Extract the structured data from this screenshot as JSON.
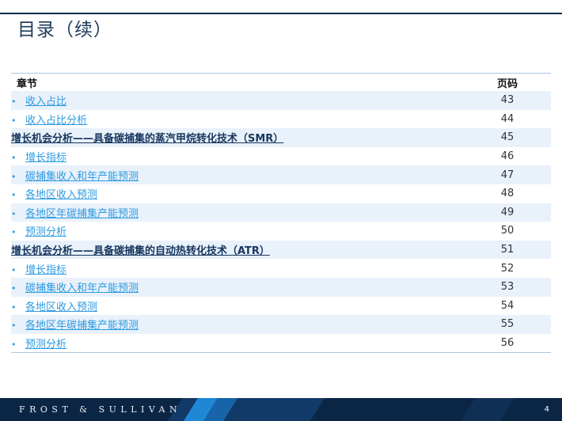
{
  "page": {
    "title": "目录（续）",
    "page_number": "4"
  },
  "table": {
    "col_section": "章节",
    "col_page": "页码",
    "rows": [
      {
        "kind": "sub",
        "label": "收入占比",
        "page": "43"
      },
      {
        "kind": "sub",
        "label": "收入占比分析",
        "page": "44"
      },
      {
        "kind": "head",
        "label": "增长机会分析——具备碳捕集的蒸汽甲烷转化技术（SMR）",
        "page": "45"
      },
      {
        "kind": "sub",
        "label": "增长指标",
        "page": "46"
      },
      {
        "kind": "sub",
        "label": "碳捕集收入和年产能预测",
        "page": "47"
      },
      {
        "kind": "sub",
        "label": "各地区收入预测",
        "page": "48"
      },
      {
        "kind": "sub",
        "label": "各地区年碳捕集产能预测",
        "page": "49"
      },
      {
        "kind": "sub",
        "label": "预测分析",
        "page": "50"
      },
      {
        "kind": "head",
        "label": "增长机会分析——具备碳捕集的自动热转化技术（ATR）",
        "page": "51"
      },
      {
        "kind": "sub",
        "label": "增长指标",
        "page": "52"
      },
      {
        "kind": "sub",
        "label": "碳捕集收入和年产能预测",
        "page": "53"
      },
      {
        "kind": "sub",
        "label": "各地区收入预测",
        "page": "54"
      },
      {
        "kind": "sub",
        "label": "各地区年碳捕集产能预测",
        "page": "55"
      },
      {
        "kind": "sub",
        "label": "预测分析",
        "page": "56"
      }
    ]
  },
  "footer": {
    "brand": "FROST & SULLIVAN"
  },
  "colors": {
    "link": "#2e9be0",
    "heading_link": "#17365d",
    "footer_bg": "#0b2545",
    "row_alt": "#e9f1fb"
  }
}
